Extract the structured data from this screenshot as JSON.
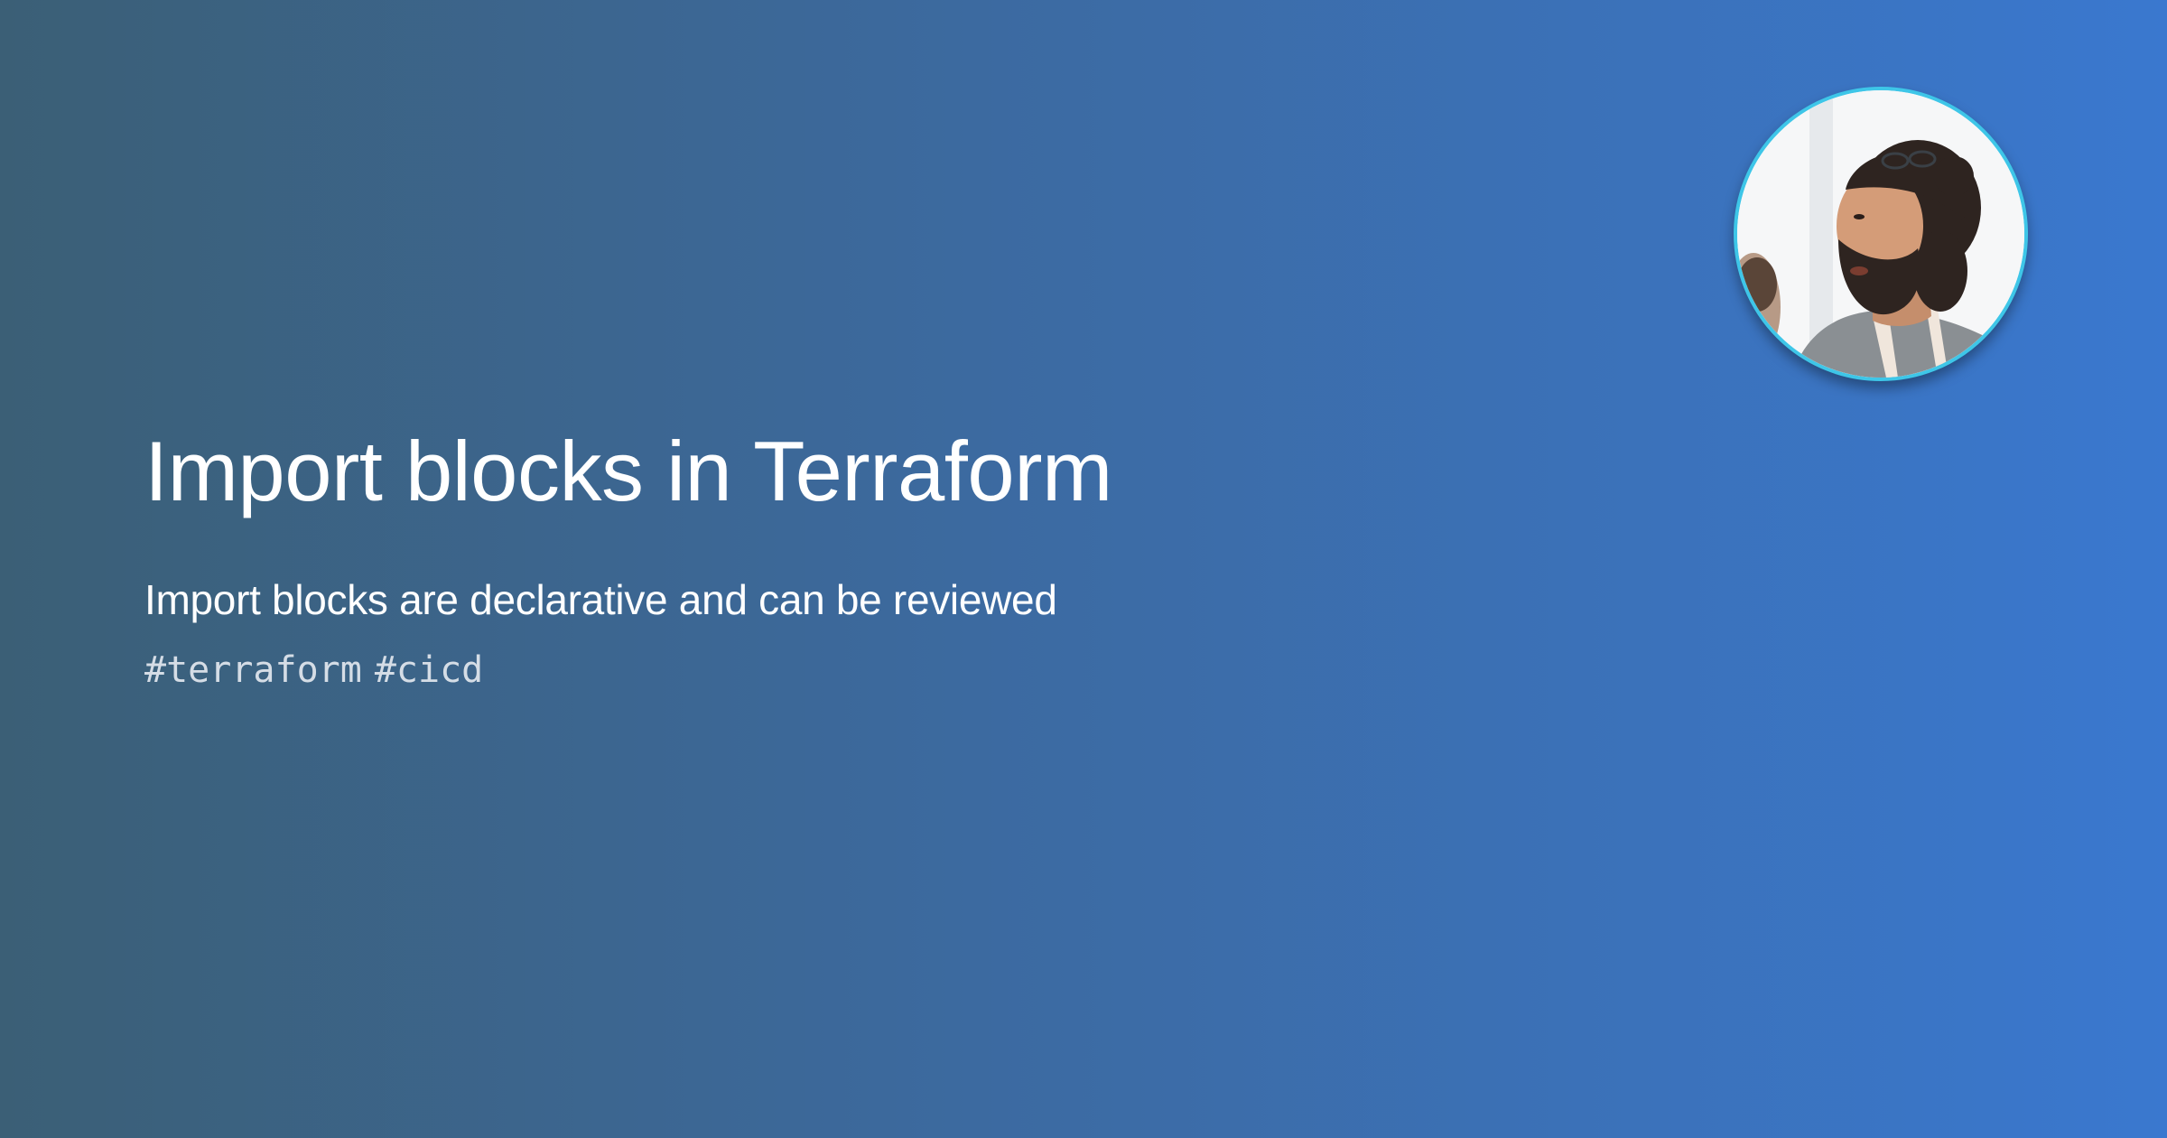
{
  "card": {
    "title": "Import blocks in Terraform",
    "subtitle": "Import blocks are declarative and can be reviewed",
    "tags": [
      "#terraform",
      "#cicd"
    ]
  },
  "avatar": {
    "icon": "author-photo"
  },
  "colors": {
    "gradient_start": "#3b5f76",
    "gradient_end": "#3a78cf",
    "avatar_ring": "#3ec6e8",
    "tag_text": "#d5dde6"
  }
}
